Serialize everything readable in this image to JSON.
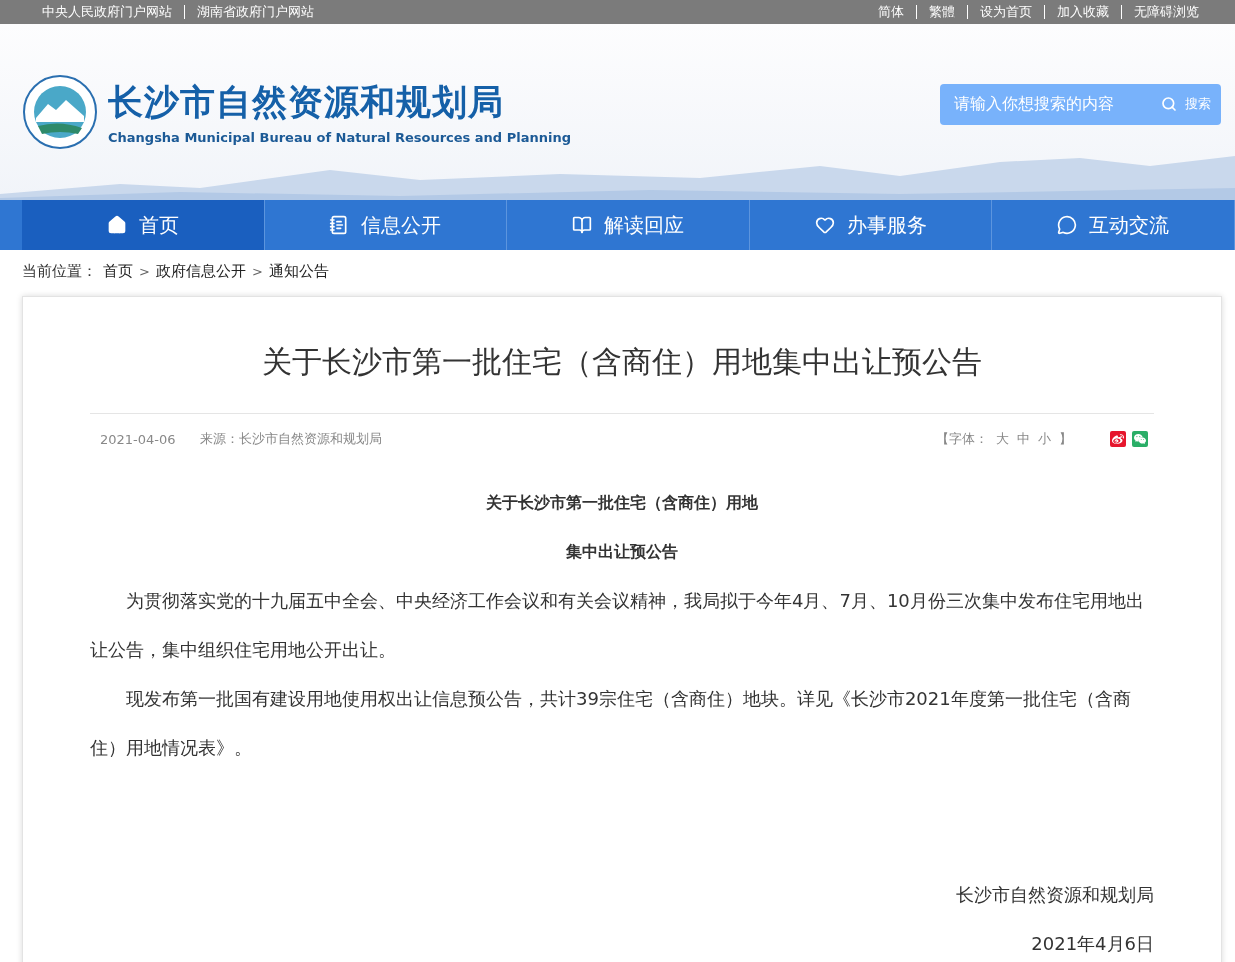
{
  "top_bar": {
    "left_links": [
      "中央人民政府门户网站",
      "湖南省政府门户网站"
    ],
    "right_links": [
      "简体",
      "繁體",
      "设为首页",
      "加入收藏",
      "无障碍浏览"
    ]
  },
  "header": {
    "title": "长沙市自然资源和规划局",
    "subtitle": "Changsha Municipal Bureau of Natural Resources and Planning",
    "search": {
      "placeholder": "请输入你想搜索的内容",
      "button": "搜索"
    }
  },
  "nav": {
    "items": [
      {
        "label": "首页",
        "selected": true,
        "kind": "home"
      },
      {
        "label": "信息公开",
        "selected": false,
        "kind": "notebook"
      },
      {
        "label": "解读回应",
        "selected": false,
        "kind": "book"
      },
      {
        "label": "办事服务",
        "selected": false,
        "kind": "heart"
      },
      {
        "label": "互动交流",
        "selected": false,
        "kind": "chat"
      }
    ]
  },
  "breadcrumb": {
    "label": "当前位置：",
    "items": [
      {
        "kind": "link",
        "text": "首页"
      },
      {
        "kind": "sep",
        "text": ">"
      },
      {
        "kind": "link",
        "text": "政府信息公开"
      },
      {
        "kind": "sep",
        "text": ">"
      },
      {
        "kind": "link",
        "text": "通知公告"
      }
    ]
  },
  "article": {
    "title": "关于长沙市第一批住宅（含商住）用地集中出让预公告",
    "date": "2021-04-06",
    "source": "来源：长沙市自然资源和规划局",
    "font_size": {
      "open": "【字体：",
      "options": [
        "大",
        "中",
        "小"
      ],
      "close": "】"
    },
    "heading_lines": [
      "关于长沙市第一批住宅（含商住）用地",
      "集中出让预公告"
    ],
    "paragraphs": [
      "为贯彻落实党的十九届五中全会、中央经济工作会议和有关会议精神，我局拟于今年4月、7月、10月份三次集中发布住宅用地出让公告，集中组织住宅用地公开出让。",
      "现发布第一批国有建设用地使用权出让信息预公告，共计39宗住宅（含商住）地块。详见《长沙市2021年度第一批住宅（含商住）用地情况表》。"
    ],
    "signature": "长沙市自然资源和规划局",
    "signed_date": "2021年4月6日"
  }
}
